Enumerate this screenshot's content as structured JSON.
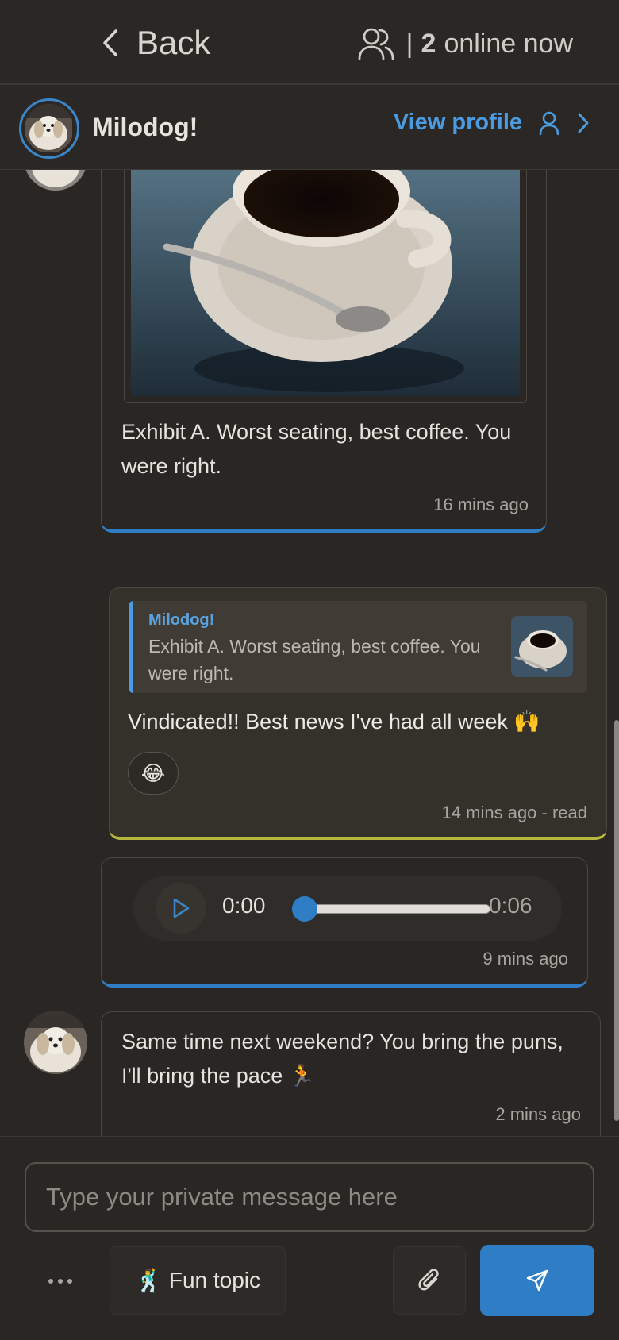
{
  "header": {
    "back_label": "Back",
    "online_separator": "|",
    "online_count": "2",
    "online_text": "online now"
  },
  "profile": {
    "name": "Milodog!",
    "view_profile_label": "View profile"
  },
  "messages": [
    {
      "type": "image",
      "caption": "Exhibit A. Worst seating, best coffee. You were right.",
      "time": "16 mins ago"
    },
    {
      "type": "reply",
      "quoted_name": "Milodog!",
      "quoted_text": "Exhibit A. Worst seating, best coffee. You were right.",
      "text": "Vindicated!! Best news I've had all week 🙌",
      "reaction": "😂",
      "time": "14 mins ago - read"
    },
    {
      "type": "audio",
      "current_time": "0:00",
      "duration": "0:06",
      "progress": 0,
      "time": "9 mins ago"
    },
    {
      "type": "text",
      "text": "Same time next weekend? You bring the puns, I'll bring the pace 🏃",
      "time": "2 mins ago"
    }
  ],
  "composer": {
    "placeholder": "Type your private message here",
    "fun_topic_emoji": "🕺",
    "fun_topic_label": "Fun topic"
  },
  "colors": {
    "accent": "#2f7dc4",
    "link": "#4a9be0",
    "outgoing_border": "#b6b83e",
    "background": "#2a2624"
  },
  "icons": [
    "chevron-left-icon",
    "users-icon",
    "user-icon",
    "chevron-right-icon",
    "play-icon",
    "ellipsis-icon",
    "paperclip-icon",
    "send-icon"
  ]
}
